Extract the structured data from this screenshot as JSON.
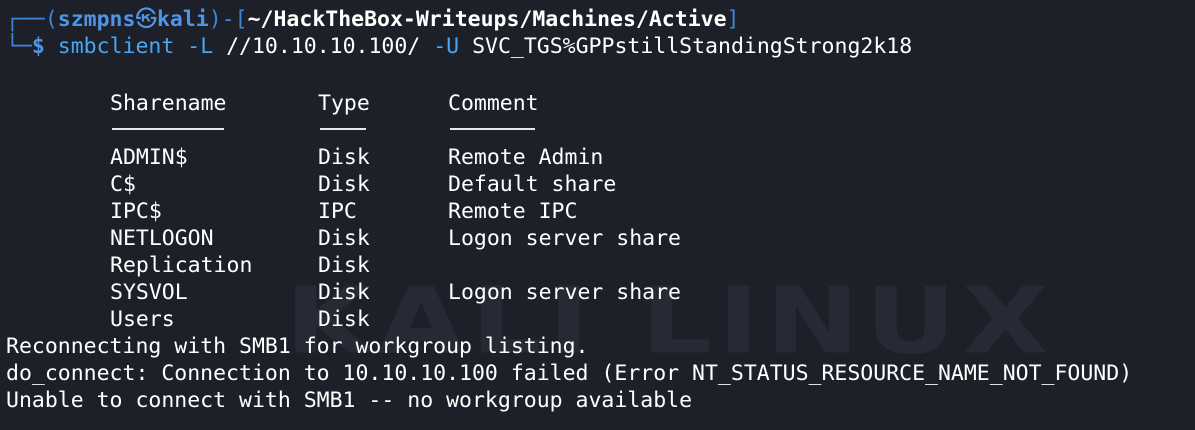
{
  "prompt": {
    "open": "┌──(",
    "user": "szmpns",
    "skull": "㉿",
    "host": "kali",
    "mid": ")-[",
    "path": "~/HackTheBox-Writeups/Machines/Active",
    "close": "]",
    "line2_prefix": "└─",
    "symbol": "$"
  },
  "command": {
    "program": "smbclient",
    "flag1": "-L",
    "target": "//10.10.10.100/",
    "flag2": "-U",
    "credential": "SVC_TGS%GPPstillStandingStrong2k18"
  },
  "table": {
    "headers": [
      "Sharename",
      "Type",
      "Comment"
    ],
    "rows": [
      {
        "name": "ADMIN$",
        "type": "Disk",
        "comment": "Remote Admin"
      },
      {
        "name": "C$",
        "type": "Disk",
        "comment": "Default share"
      },
      {
        "name": "IPC$",
        "type": "IPC",
        "comment": "Remote IPC"
      },
      {
        "name": "NETLOGON",
        "type": "Disk",
        "comment": "Logon server share"
      },
      {
        "name": "Replication",
        "type": "Disk",
        "comment": ""
      },
      {
        "name": "SYSVOL",
        "type": "Disk",
        "comment": "Logon server share"
      },
      {
        "name": "Users",
        "type": "Disk",
        "comment": ""
      }
    ]
  },
  "output": [
    "Reconnecting with SMB1 for workgroup listing.",
    "do_connect: Connection to 10.10.10.100 failed (Error NT_STATUS_RESOURCE_NAME_NOT_FOUND)",
    "Unable to connect with SMB1 -- no workgroup available"
  ],
  "watermark": "KALI LINUX",
  "colors": {
    "background": "#1e2029",
    "prompt_blue": "#4f95e6",
    "command_blue": "#49a6f0",
    "text": "#ffffff"
  }
}
